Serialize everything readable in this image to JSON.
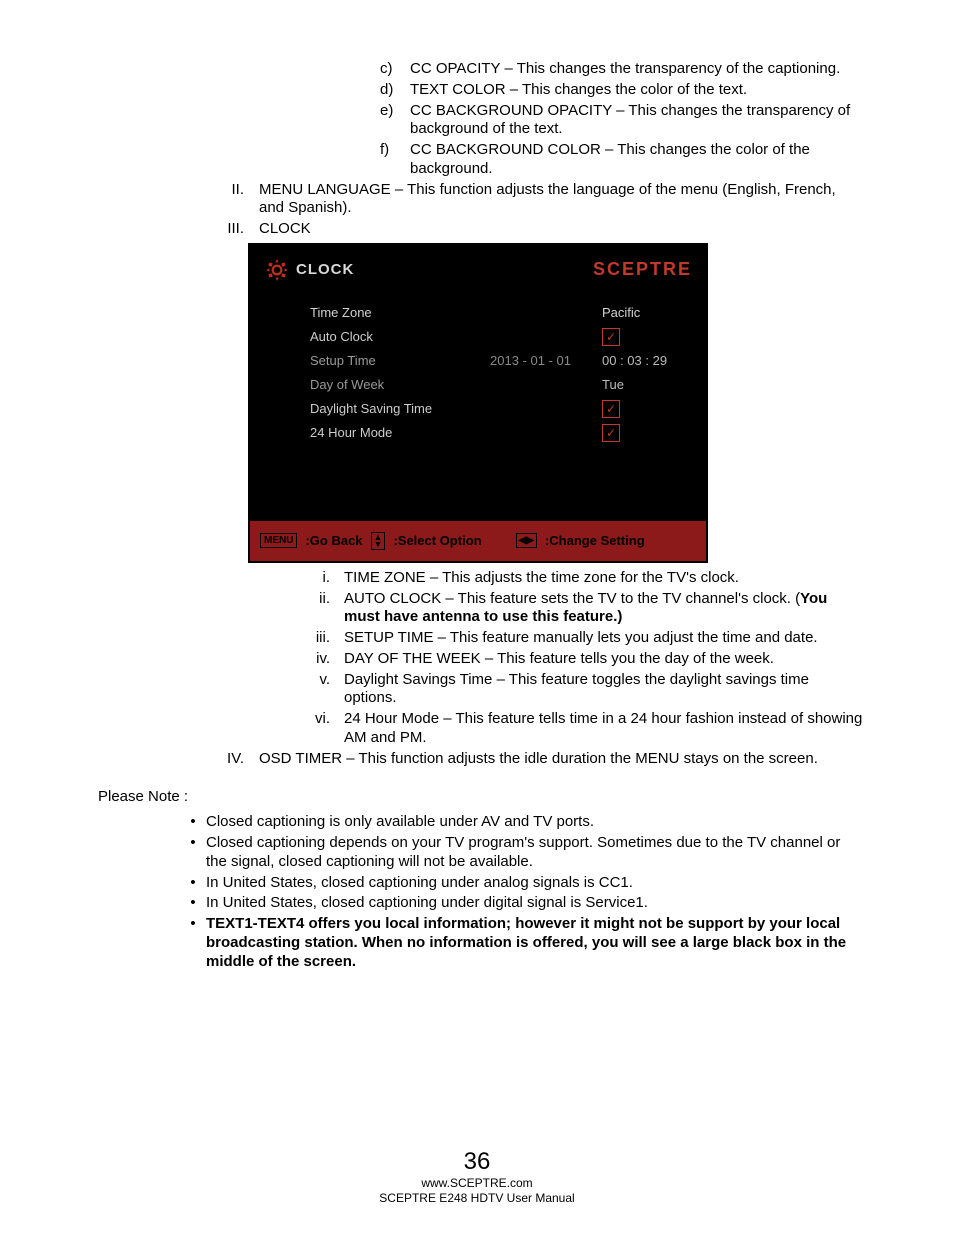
{
  "abc_items": [
    {
      "m": "c)",
      "t": "CC OPACITY – This changes the transparency of the captioning."
    },
    {
      "m": "d)",
      "t": "TEXT COLOR – This changes the color of the text."
    },
    {
      "m": "e)",
      "t": "CC BACKGROUND OPACITY – This changes the transparency of background of the text."
    },
    {
      "m": "f)",
      "t": "CC BACKGROUND COLOR – This changes the color of the background."
    }
  ],
  "roman_II": {
    "m": "II.",
    "t": "MENU LANGUAGE – This function adjusts the language of the menu (English, French, and Spanish)."
  },
  "roman_III": {
    "m": "III.",
    "t": "CLOCK"
  },
  "osd": {
    "title": "CLOCK",
    "brand": "SCEPTRE",
    "rows": {
      "tz": {
        "label": "Time Zone",
        "mid": "",
        "val": "Pacific"
      },
      "auto": {
        "label": "Auto Clock",
        "mid": "",
        "val": "check"
      },
      "setup": {
        "label": "Setup Time",
        "mid": "2013 - 01 - 01",
        "val": "00 : 03 : 29"
      },
      "dow": {
        "label": "Day of Week",
        "mid": "",
        "val": "Tue"
      },
      "dst": {
        "label": "Daylight Saving Time",
        "mid": "",
        "val": "check"
      },
      "h24": {
        "label": "24 Hour Mode",
        "mid": "",
        "val": "check"
      }
    },
    "footer": {
      "menu": "MENU",
      "back": ":Go Back",
      "select": ":Select Option",
      "change": ":Change Setting"
    }
  },
  "sub_roman": [
    {
      "m": "i.",
      "t": "TIME ZONE – This adjusts the time zone for the TV's clock."
    },
    {
      "m": "ii.",
      "t": "AUTO CLOCK – This feature sets the TV to the TV channel's clock.  (",
      "bold": "You must have antenna to use this feature.)"
    },
    {
      "m": "iii.",
      "t": "SETUP TIME – This feature manually lets you adjust the time and date."
    },
    {
      "m": "iv.",
      "t": "DAY OF THE WEEK – This feature tells you the day of the week."
    },
    {
      "m": "v.",
      "t": "Daylight Savings Time – This feature toggles the daylight savings time options."
    },
    {
      "m": "vi.",
      "t": "24 Hour Mode – This feature tells time in a 24 hour fashion instead of showing AM and PM."
    }
  ],
  "roman_IV": {
    "m": "IV.",
    "t": "OSD TIMER – This function adjusts the idle duration the MENU stays on the screen."
  },
  "please_note": "Please Note :",
  "bullets": [
    {
      "t": "Closed captioning is only available under AV and TV ports."
    },
    {
      "t": "Closed captioning depends on your TV program's support. Sometimes due to the TV channel or the signal, closed captioning will not be available."
    },
    {
      "t": "In United States, closed captioning under analog signals is CC1."
    },
    {
      "t": "In United States, closed captioning under digital signal is Service1."
    },
    {
      "bold": "TEXT1-TEXT4 offers you local information; however it might not be support by your local broadcasting station. When no information is offered, you will see a large black box in the middle of the screen."
    }
  ],
  "footer": {
    "page": "36",
    "url": "www.SCEPTRE.com",
    "manual": "SCEPTRE E248 HDTV User Manual"
  }
}
